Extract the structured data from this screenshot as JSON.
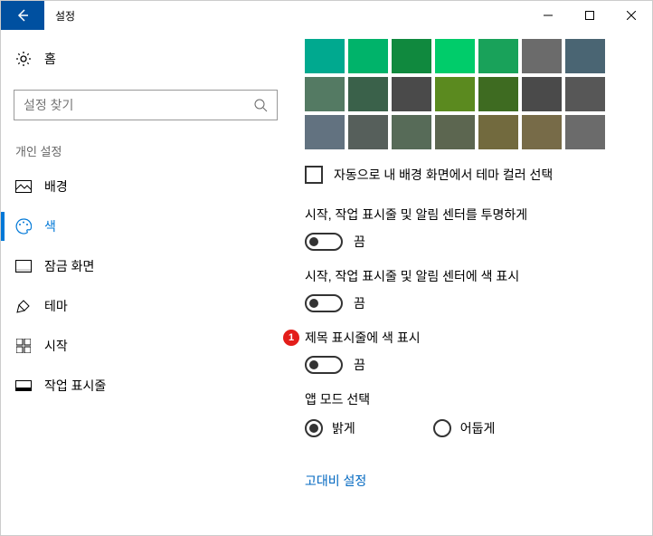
{
  "titlebar": {
    "title": "설정"
  },
  "sidebar": {
    "home_label": "홈",
    "search_placeholder": "설정 찾기",
    "section_header": "개인 설정",
    "items": [
      {
        "label": "배경"
      },
      {
        "label": "색"
      },
      {
        "label": "잠금 화면"
      },
      {
        "label": "테마"
      },
      {
        "label": "시작"
      },
      {
        "label": "작업 표시줄"
      }
    ]
  },
  "main": {
    "swatches": [
      "#00a98f",
      "#00b36a",
      "#10893e",
      "#00cc6a",
      "#19a25a",
      "#6b6b6b",
      "#4a6573",
      "#547a63",
      "#3a614a",
      "#4a4a4a",
      "#5b8a1f",
      "#3e6b21",
      "#4a4a4a",
      "#575757",
      "#627280",
      "#565f5b",
      "#576b58",
      "#5c6650",
      "#726a3e",
      "#776b48",
      "#6b6b6b"
    ],
    "auto_theme_checkbox": "자동으로 내 배경 화면에서 테마 컬러 선택",
    "settings": [
      {
        "title": "시작, 작업 표시줄 및 알림 센터를 투명하게",
        "state": "끔"
      },
      {
        "title": "시작, 작업 표시줄 및 알림 센터에 색 표시",
        "state": "끔"
      },
      {
        "title": "제목 표시줄에 색 표시",
        "state": "끔",
        "badge": "1"
      }
    ],
    "mode_title": "앱 모드 선택",
    "mode_options": [
      {
        "label": "밝게",
        "checked": true
      },
      {
        "label": "어둡게",
        "checked": false
      }
    ],
    "contrast_link": "고대비 설정"
  }
}
